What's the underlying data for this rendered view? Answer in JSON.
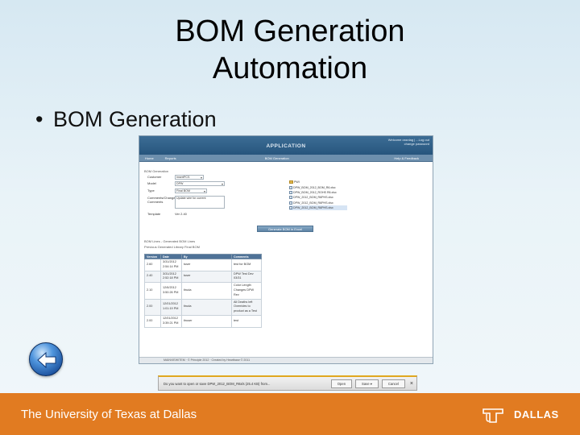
{
  "slide": {
    "title_line1": "BOM Generation",
    "title_line2": "Automation",
    "bullet": "BOM Generation",
    "footer_university": "The University of Texas at Dallas",
    "footer_logo_text": "DALLAS"
  },
  "app": {
    "title": "APPLICATION",
    "welcome": "Welcome cssnlag | ...Log out",
    "change_password": "change password",
    "nav": [
      "Home",
      "Reports",
      "BOM Generation",
      "Help & Feedback"
    ],
    "section_title": "BOM Generation",
    "form": {
      "customer_label": "Customer",
      "customer_value": "InsertPCS",
      "model_label": "Model",
      "model_value": "DPW",
      "type_label": "Type",
      "type_value": "Final BOM",
      "comments_label": "Comments/Change Comments",
      "comments_value": "Update wire for current",
      "template_label": "Template",
      "template_value": "Ver 2.40"
    },
    "tree": {
      "root": "PWI",
      "items": [
        "DPW_BOM_2012_BOM_R6.xlsx",
        "DPW_BOM_2012_ROHS R6.xlsx",
        "DPW_2012_BOM_R6PHS.xlsx",
        "DPW_2012_BOM_R6PHS.xlsx",
        "DPW_2012_BOM_R6PHS.xlsx"
      ]
    },
    "generate_button": "Generate BOM in Excel",
    "grid_caption": "BOM Lines - Generated BOM Lines",
    "grid_subcaption": "Previous Generated Library   Final BOM",
    "grid_headers": [
      "Version",
      "Date",
      "By",
      "Comments"
    ],
    "grid_rows": [
      [
        "2.60",
        "3/31/2012 2:54:14 PM",
        "tuser",
        "test for BOM"
      ],
      [
        "2.40",
        "3/31/2012 2:52:18 PM",
        "tuser",
        "DPW Test Dev 03/31"
      ],
      [
        "2.10",
        "12/6/2012 3:50:26 PM",
        "tiruda",
        "Color Length Changes DPW Rev"
      ],
      [
        "2.00",
        "12/01/2012 1:01:19 PM",
        "tiruda",
        "All Deaths left Overrides to product as a Test"
      ],
      [
        "2.00",
        "12/01/2012 3:39:21 PM",
        "tiruser",
        "test"
      ]
    ],
    "status_text": "MAINVIEWITEM · © Principle 2012 · Created by Heartbase © 2011"
  },
  "download_bar": {
    "text": "Do you want to open or save DPW_2012_BOM_R6xls (25.4 KB) from..."
  },
  "colors": {
    "slide_bg": "#e1edf4",
    "app_header": "#2d5e89",
    "nav_bar": "#6d8fad",
    "grid_header": "#4f7297",
    "download_accent": "#e0a820",
    "footer": "#e17b21"
  },
  "icons": [
    "back-arrow-icon",
    "folder-icon",
    "excel-file-icon",
    "close-icon",
    "ut-logo-icon"
  ]
}
